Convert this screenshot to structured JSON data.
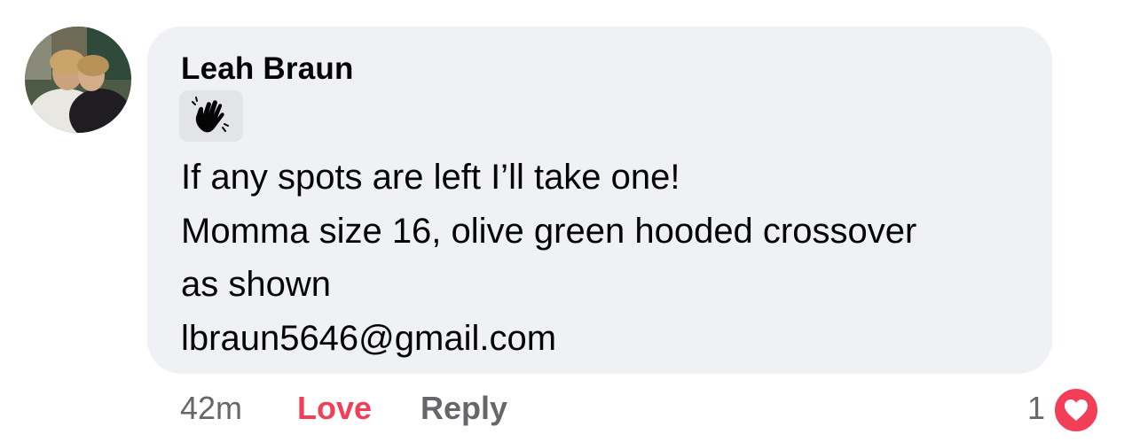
{
  "comment": {
    "author": "Leah Braun",
    "badge_icon": "waving-hand-icon",
    "lines": [
      "If any spots are left I’ll take one!",
      "Momma size 16, olive green hooded crossover",
      "as shown",
      "lbraun5646@gmail.com"
    ],
    "timestamp": "42m",
    "love_label": "Love",
    "reply_label": "Reply",
    "reaction_count": "1",
    "reaction_icon": "heart-reaction-icon"
  },
  "colors": {
    "bubble": "#f0f1f5",
    "love": "#f33e58",
    "muted": "#65676b",
    "text": "#050505"
  }
}
